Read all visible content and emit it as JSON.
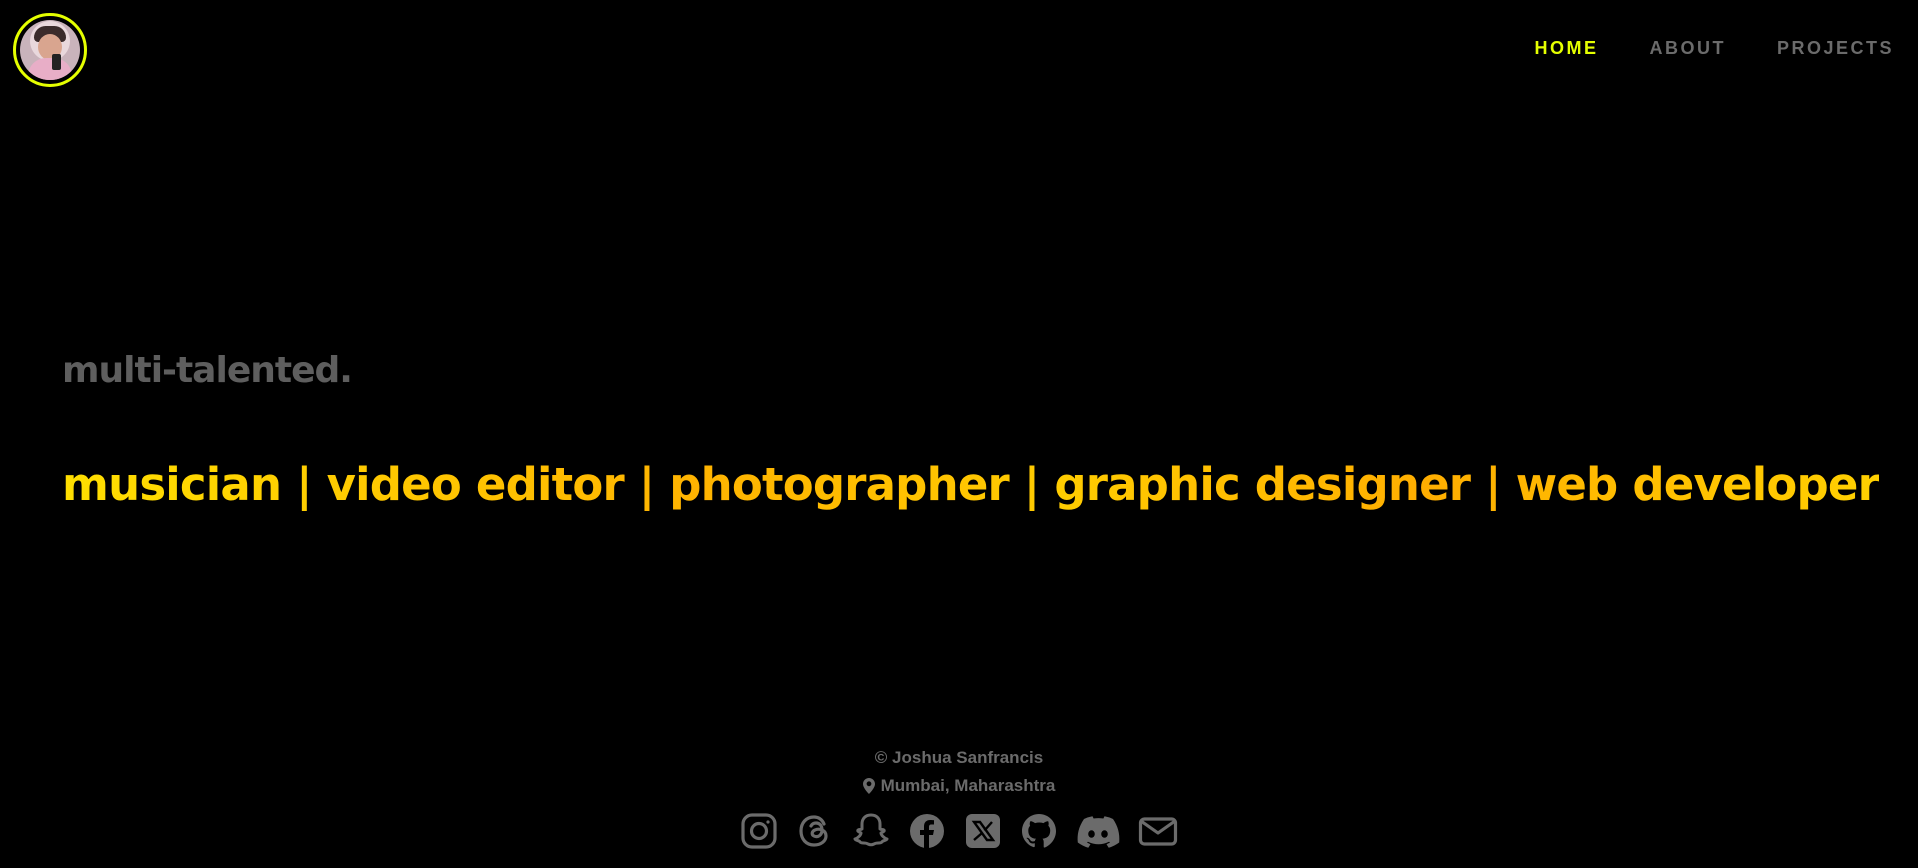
{
  "header": {
    "nav": [
      {
        "label": "HOME",
        "active": true
      },
      {
        "label": "ABOUT",
        "active": false
      },
      {
        "label": "PROJECTS",
        "active": false
      }
    ]
  },
  "hero": {
    "tagline": "multi-talented.",
    "roles": "musician | video editor | photographer | graphic designer | web developer"
  },
  "footer": {
    "copyright": "© Joshua Sanfrancis",
    "location": "Mumbai, Maharashtra",
    "socials": [
      "instagram-icon",
      "threads-icon",
      "snapchat-icon",
      "facebook-icon",
      "x-icon",
      "github-icon",
      "discord-icon",
      "mail-icon"
    ]
  },
  "colors": {
    "background": "#000000",
    "accent": "#e5ff00",
    "muted": "#6b6b6b",
    "gradient_start": "#ffdf00",
    "gradient_mid": "#ffb300"
  }
}
